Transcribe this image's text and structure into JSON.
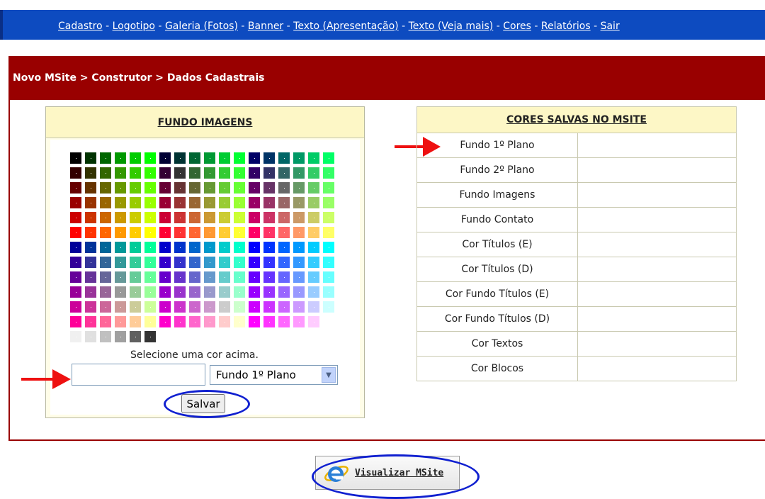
{
  "nav": {
    "links": [
      "Cadastro",
      "Logotipo",
      "Galeria (Fotos)",
      "Banner",
      "Texto (Apresentação)",
      "Texto (Veja mais)",
      "Cores",
      "Relatórios",
      "Sair"
    ],
    "separator": " - "
  },
  "breadcrumb": "Novo MSite > Construtor > Dados Cadastrais",
  "fundo_imagens": {
    "title": "FUNDO IMAGENS",
    "hint": "Selecione uma cor acima.",
    "color_value": "",
    "selected_option": "Fundo 1º Plano",
    "save_label": "Salvar"
  },
  "cores_salvas": {
    "title": "CORES SALVAS NO MSITE",
    "rows": [
      {
        "label": "Fundo 1º Plano",
        "value": ""
      },
      {
        "label": "Fundo 2º Plano",
        "value": ""
      },
      {
        "label": "Fundo Imagens",
        "value": ""
      },
      {
        "label": "Fundo Contato",
        "value": ""
      },
      {
        "label": "Cor Títulos (E)",
        "value": ""
      },
      {
        "label": "Cor Títulos (D)",
        "value": ""
      },
      {
        "label": "Cor Fundo Títulos (E)",
        "value": ""
      },
      {
        "label": "Cor Fundo Títulos (D)",
        "value": ""
      },
      {
        "label": "Cor Textos",
        "value": ""
      },
      {
        "label": "Cor Blocos",
        "value": ""
      }
    ]
  },
  "visualizar_label": "Visualizar MSite",
  "colors": {
    "nav_bg": "#0d4bc0",
    "header_bg": "#990000",
    "box_header_bg": "#fdf7c6",
    "annotation_red": "#ee1111",
    "annotation_blue": "#1020d0"
  },
  "icons": [
    "red-arrow-icon",
    "internet-explorer-icon",
    "dropdown-arrow-icon"
  ]
}
